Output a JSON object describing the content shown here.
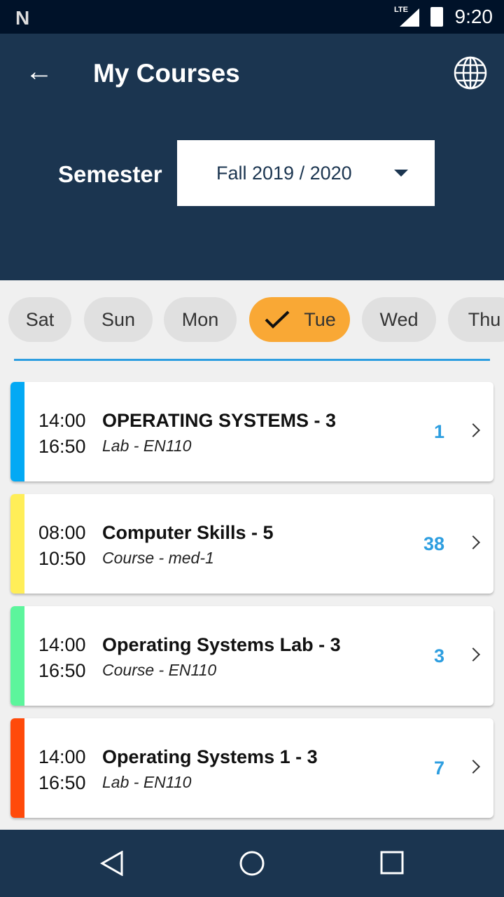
{
  "status_bar": {
    "time": "9:20",
    "network": "LTE",
    "notification_icon": "n-logo-icon"
  },
  "header": {
    "title": "My Courses",
    "semester_label": "Semester",
    "semester_value": "Fall  2019 / 2020"
  },
  "days": [
    {
      "label": "Sat",
      "selected": false
    },
    {
      "label": "Sun",
      "selected": false
    },
    {
      "label": "Mon",
      "selected": false
    },
    {
      "label": "Tue",
      "selected": true
    },
    {
      "label": "Wed",
      "selected": false
    },
    {
      "label": "Thu",
      "selected": false
    }
  ],
  "colors": {
    "header": "#1b3550",
    "selected_day": "#f9a835",
    "accent": "#2d9ee0"
  },
  "courses": [
    {
      "start": "14:00",
      "end": "16:50",
      "name": "OPERATING SYSTEMS - 3",
      "subtitle": "Lab - EN110",
      "count": "1",
      "color": "#03a9f4"
    },
    {
      "start": "08:00",
      "end": "10:50",
      "name": "Computer Skills - 5",
      "subtitle": "Course - med-1",
      "count": "38",
      "color": "#ffee58"
    },
    {
      "start": "14:00",
      "end": "16:50",
      "name": "Operating Systems Lab - 3",
      "subtitle": "Course - EN110",
      "count": "3",
      "color": "#5cf59c"
    },
    {
      "start": "14:00",
      "end": "16:50",
      "name": "Operating Systems 1 - 3",
      "subtitle": "Lab - EN110",
      "count": "7",
      "color": "#ff4a0a"
    }
  ]
}
